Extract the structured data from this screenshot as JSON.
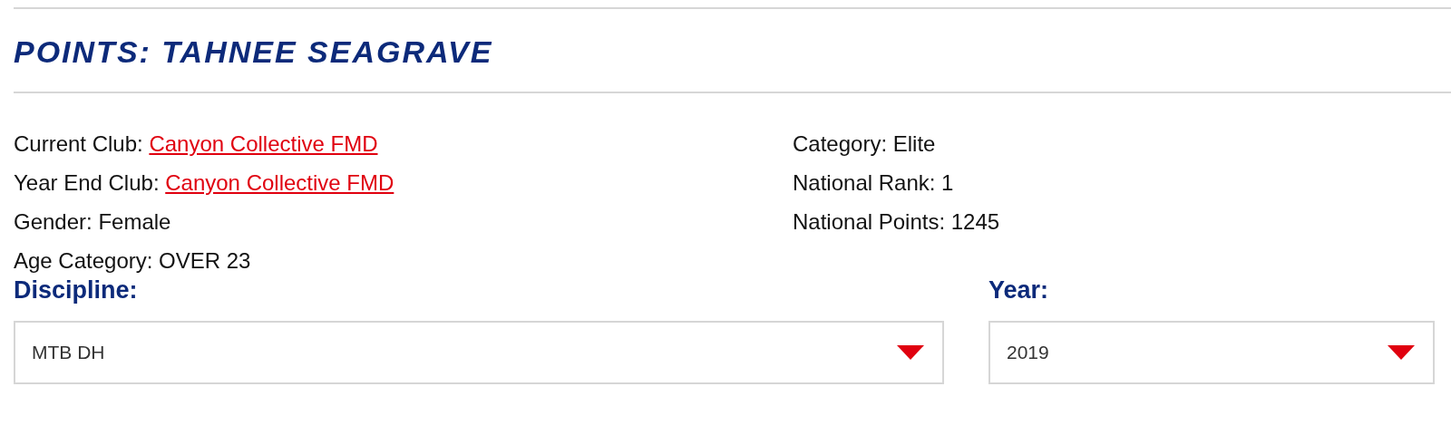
{
  "title": "POINTS: TAHNEE SEAGRAVE",
  "details_left": [
    {
      "kind": "link",
      "label": "Current Club:",
      "value": "Canyon Collective FMD"
    },
    {
      "kind": "link",
      "label": "Year End Club:",
      "value": "Canyon Collective FMD"
    },
    {
      "kind": "text",
      "label": "Gender:",
      "value": "Female"
    },
    {
      "kind": "text",
      "label": "Age Category:",
      "value": "OVER 23"
    }
  ],
  "details_right": [
    {
      "kind": "text",
      "label": "Category:",
      "value": "Elite"
    },
    {
      "kind": "text",
      "label": "National Rank:",
      "value": "1"
    },
    {
      "kind": "text",
      "label": "National Points:",
      "value": "1245"
    }
  ],
  "filters": [
    {
      "label": "Discipline:",
      "value": "MTB DH"
    },
    {
      "label": "Year:",
      "value": "2019"
    }
  ]
}
